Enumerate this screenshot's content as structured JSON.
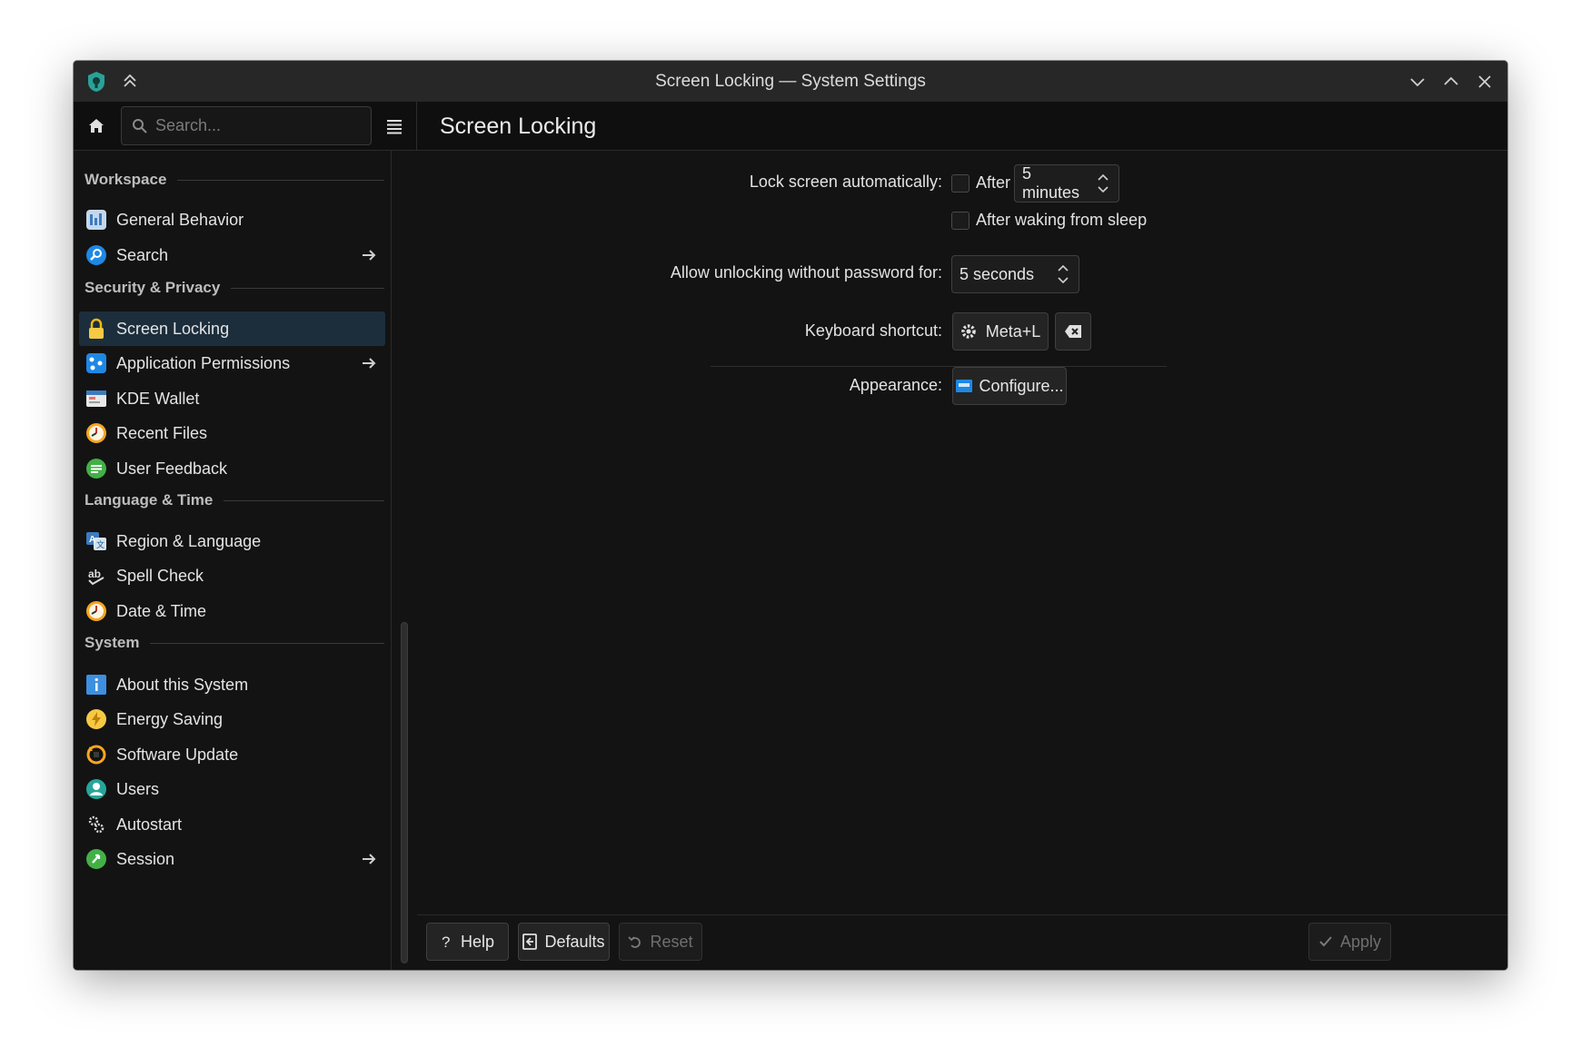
{
  "window": {
    "title": "Screen Locking — System Settings"
  },
  "toolbar": {
    "search_placeholder": "Search...",
    "page_title": "Screen Locking"
  },
  "sidebar": {
    "sections": [
      {
        "title": "Workspace"
      },
      {
        "title": "Security & Privacy"
      },
      {
        "title": "Language & Time"
      },
      {
        "title": "System"
      }
    ],
    "items": [
      {
        "label": "General Behavior",
        "icon": "general-behavior-icon",
        "has_arrow": false
      },
      {
        "label": "Search",
        "icon": "search-icon",
        "has_arrow": true
      },
      {
        "label": "Screen Locking",
        "icon": "lock-icon",
        "has_arrow": false,
        "active": true
      },
      {
        "label": "Application Permissions",
        "icon": "app-permissions-icon",
        "has_arrow": true
      },
      {
        "label": "KDE Wallet",
        "icon": "wallet-icon",
        "has_arrow": false
      },
      {
        "label": "Recent Files",
        "icon": "clock-icon",
        "has_arrow": false
      },
      {
        "label": "User Feedback",
        "icon": "feedback-icon",
        "has_arrow": false
      },
      {
        "label": "Region & Language",
        "icon": "language-icon",
        "has_arrow": false
      },
      {
        "label": "Spell Check",
        "icon": "spellcheck-icon",
        "has_arrow": false
      },
      {
        "label": "Date & Time",
        "icon": "clock-icon",
        "has_arrow": false
      },
      {
        "label": "About this System",
        "icon": "info-icon",
        "has_arrow": false
      },
      {
        "label": "Energy Saving",
        "icon": "energy-icon",
        "has_arrow": false
      },
      {
        "label": "Software Update",
        "icon": "update-icon",
        "has_arrow": false
      },
      {
        "label": "Users",
        "icon": "user-icon",
        "has_arrow": false
      },
      {
        "label": "Autostart",
        "icon": "gears-icon",
        "has_arrow": false
      },
      {
        "label": "Session",
        "icon": "session-icon",
        "has_arrow": true
      }
    ]
  },
  "form": {
    "lock_auto_label": "Lock screen automatically:",
    "after_label": "After",
    "after_checked": false,
    "after_value": "5 minutes",
    "after_waking_label": "After waking from sleep",
    "after_waking_checked": false,
    "unlock_label": "Allow unlocking without password for:",
    "unlock_value": "5 seconds",
    "shortcut_label": "Keyboard shortcut:",
    "shortcut_value": "Meta+L",
    "appearance_label": "Appearance:",
    "configure_label": "Configure..."
  },
  "footer": {
    "help": "Help",
    "defaults": "Defaults",
    "reset": "Reset",
    "apply": "Apply"
  },
  "colors": {
    "accent": "#3daee9",
    "active_row": "#1c2e3c",
    "background": "#131313"
  }
}
